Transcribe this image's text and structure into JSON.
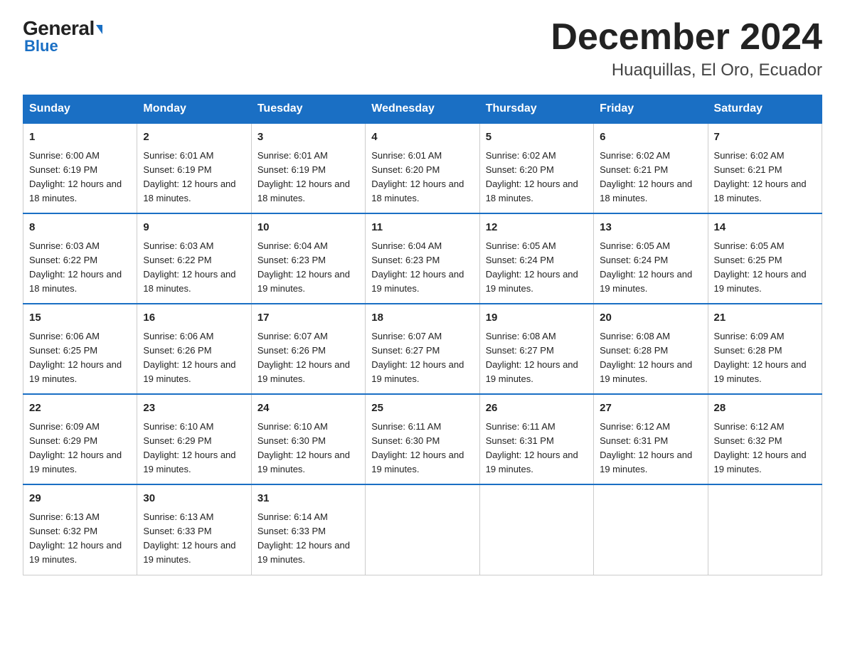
{
  "logo": {
    "general": "General",
    "blue": "Blue"
  },
  "title": "December 2024",
  "subtitle": "Huaquillas, El Oro, Ecuador",
  "weekdays": [
    "Sunday",
    "Monday",
    "Tuesday",
    "Wednesday",
    "Thursday",
    "Friday",
    "Saturday"
  ],
  "weeks": [
    [
      {
        "day": "1",
        "sunrise": "6:00 AM",
        "sunset": "6:19 PM",
        "daylight": "12 hours and 18 minutes."
      },
      {
        "day": "2",
        "sunrise": "6:01 AM",
        "sunset": "6:19 PM",
        "daylight": "12 hours and 18 minutes."
      },
      {
        "day": "3",
        "sunrise": "6:01 AM",
        "sunset": "6:19 PM",
        "daylight": "12 hours and 18 minutes."
      },
      {
        "day": "4",
        "sunrise": "6:01 AM",
        "sunset": "6:20 PM",
        "daylight": "12 hours and 18 minutes."
      },
      {
        "day": "5",
        "sunrise": "6:02 AM",
        "sunset": "6:20 PM",
        "daylight": "12 hours and 18 minutes."
      },
      {
        "day": "6",
        "sunrise": "6:02 AM",
        "sunset": "6:21 PM",
        "daylight": "12 hours and 18 minutes."
      },
      {
        "day": "7",
        "sunrise": "6:02 AM",
        "sunset": "6:21 PM",
        "daylight": "12 hours and 18 minutes."
      }
    ],
    [
      {
        "day": "8",
        "sunrise": "6:03 AM",
        "sunset": "6:22 PM",
        "daylight": "12 hours and 18 minutes."
      },
      {
        "day": "9",
        "sunrise": "6:03 AM",
        "sunset": "6:22 PM",
        "daylight": "12 hours and 18 minutes."
      },
      {
        "day": "10",
        "sunrise": "6:04 AM",
        "sunset": "6:23 PM",
        "daylight": "12 hours and 19 minutes."
      },
      {
        "day": "11",
        "sunrise": "6:04 AM",
        "sunset": "6:23 PM",
        "daylight": "12 hours and 19 minutes."
      },
      {
        "day": "12",
        "sunrise": "6:05 AM",
        "sunset": "6:24 PM",
        "daylight": "12 hours and 19 minutes."
      },
      {
        "day": "13",
        "sunrise": "6:05 AM",
        "sunset": "6:24 PM",
        "daylight": "12 hours and 19 minutes."
      },
      {
        "day": "14",
        "sunrise": "6:05 AM",
        "sunset": "6:25 PM",
        "daylight": "12 hours and 19 minutes."
      }
    ],
    [
      {
        "day": "15",
        "sunrise": "6:06 AM",
        "sunset": "6:25 PM",
        "daylight": "12 hours and 19 minutes."
      },
      {
        "day": "16",
        "sunrise": "6:06 AM",
        "sunset": "6:26 PM",
        "daylight": "12 hours and 19 minutes."
      },
      {
        "day": "17",
        "sunrise": "6:07 AM",
        "sunset": "6:26 PM",
        "daylight": "12 hours and 19 minutes."
      },
      {
        "day": "18",
        "sunrise": "6:07 AM",
        "sunset": "6:27 PM",
        "daylight": "12 hours and 19 minutes."
      },
      {
        "day": "19",
        "sunrise": "6:08 AM",
        "sunset": "6:27 PM",
        "daylight": "12 hours and 19 minutes."
      },
      {
        "day": "20",
        "sunrise": "6:08 AM",
        "sunset": "6:28 PM",
        "daylight": "12 hours and 19 minutes."
      },
      {
        "day": "21",
        "sunrise": "6:09 AM",
        "sunset": "6:28 PM",
        "daylight": "12 hours and 19 minutes."
      }
    ],
    [
      {
        "day": "22",
        "sunrise": "6:09 AM",
        "sunset": "6:29 PM",
        "daylight": "12 hours and 19 minutes."
      },
      {
        "day": "23",
        "sunrise": "6:10 AM",
        "sunset": "6:29 PM",
        "daylight": "12 hours and 19 minutes."
      },
      {
        "day": "24",
        "sunrise": "6:10 AM",
        "sunset": "6:30 PM",
        "daylight": "12 hours and 19 minutes."
      },
      {
        "day": "25",
        "sunrise": "6:11 AM",
        "sunset": "6:30 PM",
        "daylight": "12 hours and 19 minutes."
      },
      {
        "day": "26",
        "sunrise": "6:11 AM",
        "sunset": "6:31 PM",
        "daylight": "12 hours and 19 minutes."
      },
      {
        "day": "27",
        "sunrise": "6:12 AM",
        "sunset": "6:31 PM",
        "daylight": "12 hours and 19 minutes."
      },
      {
        "day": "28",
        "sunrise": "6:12 AM",
        "sunset": "6:32 PM",
        "daylight": "12 hours and 19 minutes."
      }
    ],
    [
      {
        "day": "29",
        "sunrise": "6:13 AM",
        "sunset": "6:32 PM",
        "daylight": "12 hours and 19 minutes."
      },
      {
        "day": "30",
        "sunrise": "6:13 AM",
        "sunset": "6:33 PM",
        "daylight": "12 hours and 19 minutes."
      },
      {
        "day": "31",
        "sunrise": "6:14 AM",
        "sunset": "6:33 PM",
        "daylight": "12 hours and 19 minutes."
      },
      null,
      null,
      null,
      null
    ]
  ]
}
